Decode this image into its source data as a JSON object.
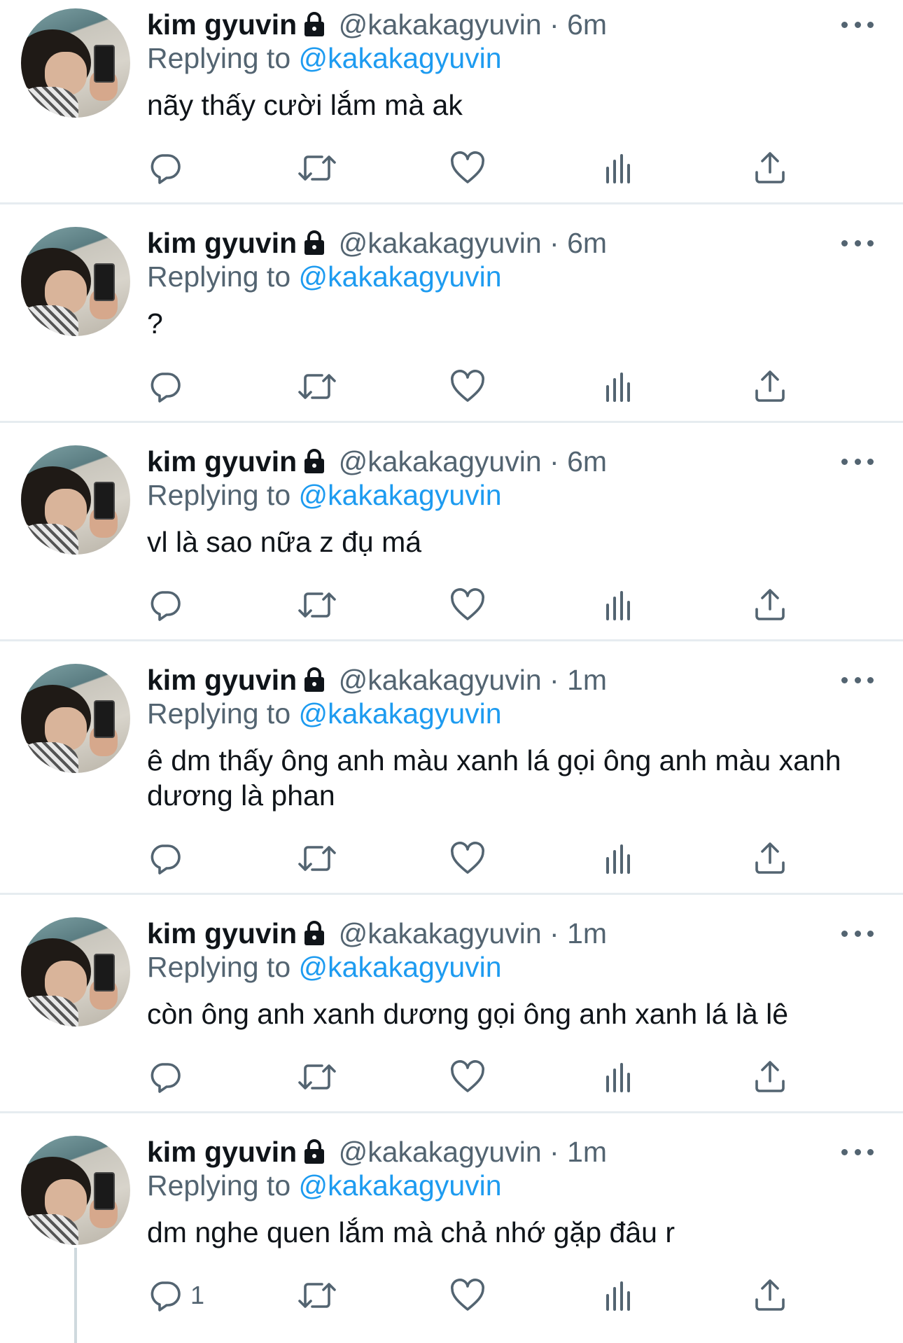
{
  "colors": {
    "text": "#0f1419",
    "secondary": "#536471",
    "link": "#1d9bf0",
    "divider": "#e6ecf0"
  },
  "icons": {
    "reply": "reply-icon",
    "retweet": "retweet-icon",
    "like": "heart-icon",
    "analytics": "analytics-icon",
    "share": "share-icon",
    "more": "more-icon",
    "protected": "lock-icon"
  },
  "tweets": [
    {
      "name": "kim gyuvin",
      "handle": "@kakakagyuvin",
      "dot": "·",
      "time": "6m",
      "replying_prefix": "Replying to",
      "replying_to": "@kakakagyuvin",
      "text": "nãy thấy cười lắm mà ak",
      "reply_count": ""
    },
    {
      "name": "kim gyuvin",
      "handle": "@kakakagyuvin",
      "dot": "·",
      "time": "6m",
      "replying_prefix": "Replying to",
      "replying_to": "@kakakagyuvin",
      "text": "?",
      "reply_count": ""
    },
    {
      "name": "kim gyuvin",
      "handle": "@kakakagyuvin",
      "dot": "·",
      "time": "6m",
      "replying_prefix": "Replying to",
      "replying_to": "@kakakagyuvin",
      "text": "vl là sao nữa z đụ má",
      "reply_count": ""
    },
    {
      "name": "kim gyuvin",
      "handle": "@kakakagyuvin",
      "dot": "·",
      "time": "1m",
      "replying_prefix": "Replying to",
      "replying_to": "@kakakagyuvin",
      "text": "ê dm thấy ông anh màu xanh lá gọi ông anh màu xanh dương là phan",
      "reply_count": ""
    },
    {
      "name": "kim gyuvin",
      "handle": "@kakakagyuvin",
      "dot": "·",
      "time": "1m",
      "replying_prefix": "Replying to",
      "replying_to": "@kakakagyuvin",
      "text": "còn ông anh xanh dương gọi ông anh xanh lá là lê",
      "reply_count": ""
    },
    {
      "name": "kim gyuvin",
      "handle": "@kakakagyuvin",
      "dot": "·",
      "time": "1m",
      "replying_prefix": "Replying to",
      "replying_to": "@kakakagyuvin",
      "text": "dm nghe quen lắm mà chả nhớ gặp đâu r",
      "reply_count": "1"
    }
  ]
}
